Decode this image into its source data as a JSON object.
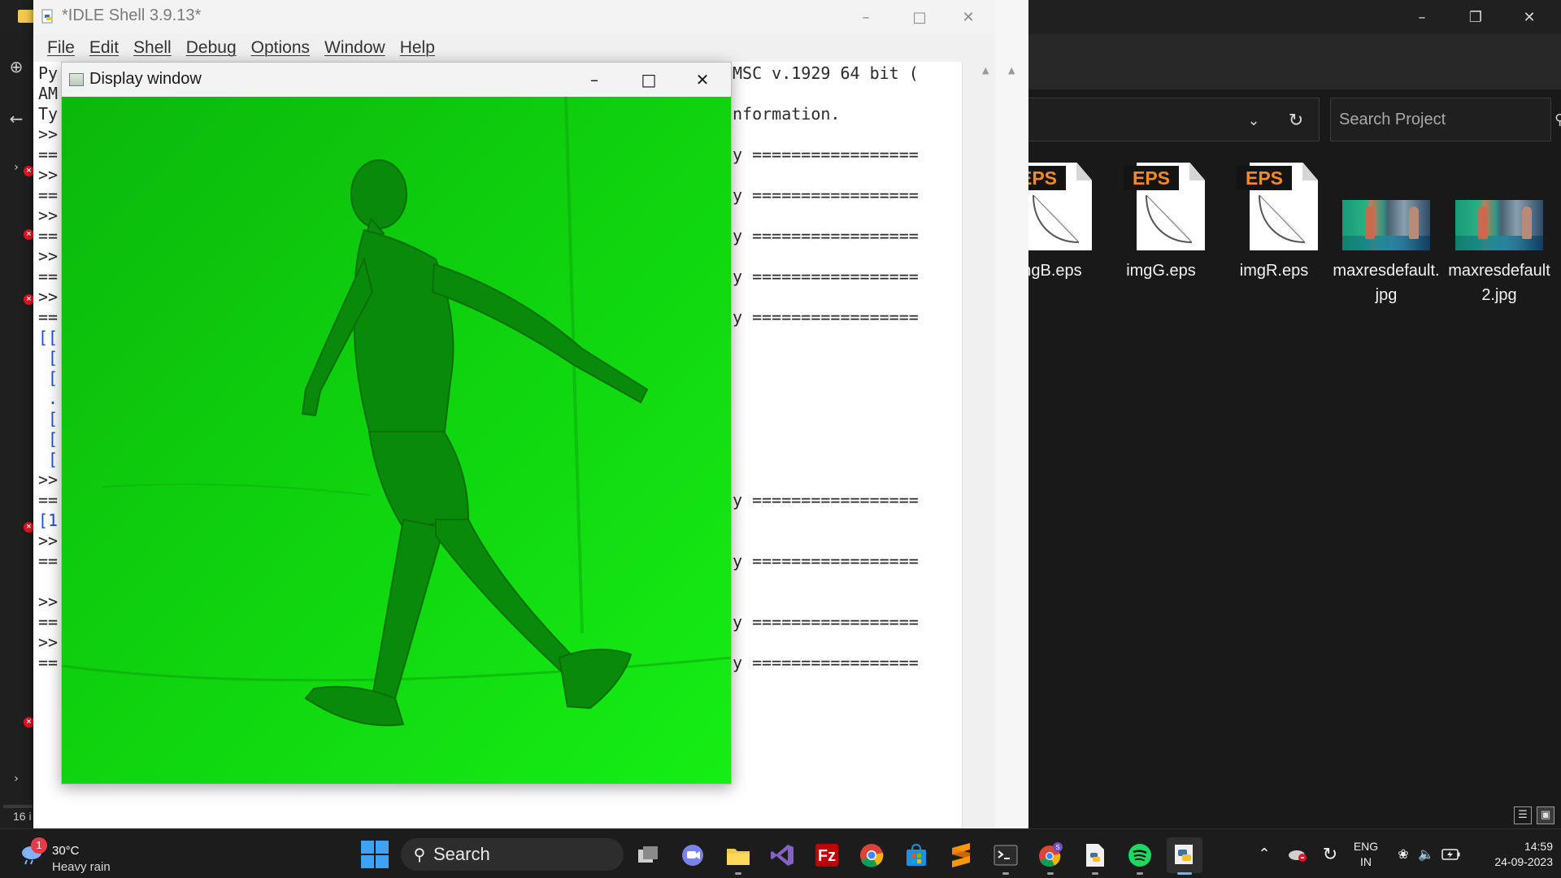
{
  "explorer": {
    "search_placeholder": "Search Project",
    "files": [
      {
        "name": "imgB.eps",
        "type": "eps",
        "badge": "EPS"
      },
      {
        "name": "imgG.eps",
        "type": "eps",
        "badge": "EPS"
      },
      {
        "name": "imgR.eps",
        "type": "eps",
        "badge": "EPS"
      },
      {
        "name": "maxresdefault.jpg",
        "type": "jpg"
      },
      {
        "name": "maxresdefault2.jpg",
        "type": "jpg"
      }
    ],
    "status_fragment": "16 i"
  },
  "idle": {
    "title": "*IDLE Shell 3.9.13*",
    "menu": [
      "File",
      "Edit",
      "Shell",
      "Debug",
      "Options",
      "Window",
      "Help"
    ],
    "left_column": [
      {
        "text": "Py",
        "style": "plain"
      },
      {
        "text": "AM",
        "style": "plain"
      },
      {
        "text": "Ty",
        "style": "plain"
      },
      {
        "text": ">>",
        "style": "plain"
      },
      {
        "text": "==",
        "style": "plain"
      },
      {
        "text": ">>",
        "style": "plain"
      },
      {
        "text": "==",
        "style": "plain"
      },
      {
        "text": ">>",
        "style": "plain"
      },
      {
        "text": "==",
        "style": "plain"
      },
      {
        "text": ">>",
        "style": "plain"
      },
      {
        "text": "==",
        "style": "plain"
      },
      {
        "text": ">>",
        "style": "plain"
      },
      {
        "text": "==",
        "style": "plain"
      },
      {
        "text": "[[",
        "style": "blue"
      },
      {
        "text": " [",
        "style": "blue"
      },
      {
        "text": " [",
        "style": "blue"
      },
      {
        "text": " .",
        "style": "blue"
      },
      {
        "text": " [",
        "style": "blue"
      },
      {
        "text": " [",
        "style": "blue"
      },
      {
        "text": " [",
        "style": "blue"
      },
      {
        "text": ">>",
        "style": "plain"
      },
      {
        "text": "==",
        "style": "plain"
      },
      {
        "text": "[1",
        "style": "blue"
      },
      {
        "text": ">>",
        "style": "plain"
      },
      {
        "text": "==",
        "style": "plain"
      },
      {
        "text": "",
        "style": "plain"
      },
      {
        "text": ">>",
        "style": "plain"
      },
      {
        "text": "==",
        "style": "plain"
      },
      {
        "text": ">>",
        "style": "plain"
      },
      {
        "text": "==",
        "style": "plain"
      }
    ],
    "right_column": [
      {
        "text": "MSC v.1929 64 bit (",
        "row": 0
      },
      {
        "text": "nformation.",
        "row": 2
      },
      {
        "text": "y =================",
        "row": 4
      },
      {
        "text": "y =================",
        "row": 6
      },
      {
        "text": "y =================",
        "row": 8
      },
      {
        "text": "y =================",
        "row": 10
      },
      {
        "text": "y =================",
        "row": 12
      },
      {
        "text": "y =================",
        "row": 21
      },
      {
        "text": "y =================",
        "row": 24
      },
      {
        "text": "y =================",
        "row": 27
      },
      {
        "text": "y =================",
        "row": 29
      }
    ]
  },
  "display_window": {
    "title": "Display window"
  },
  "taskbar": {
    "weather": {
      "temp": "30°C",
      "condition": "Heavy rain",
      "badge": "1"
    },
    "search_label": "Search",
    "apps": [
      "task-view",
      "teams-meet",
      "file-explorer",
      "visual-studio",
      "filezilla",
      "chrome",
      "ms-store",
      "sublime-text",
      "terminal",
      "chrome-profile",
      "python-file",
      "spotify",
      "python-idle"
    ],
    "lang": {
      "line1": "ENG",
      "line2": "IN"
    },
    "clock": {
      "time": "14:59",
      "date": "24-09-2023"
    }
  }
}
